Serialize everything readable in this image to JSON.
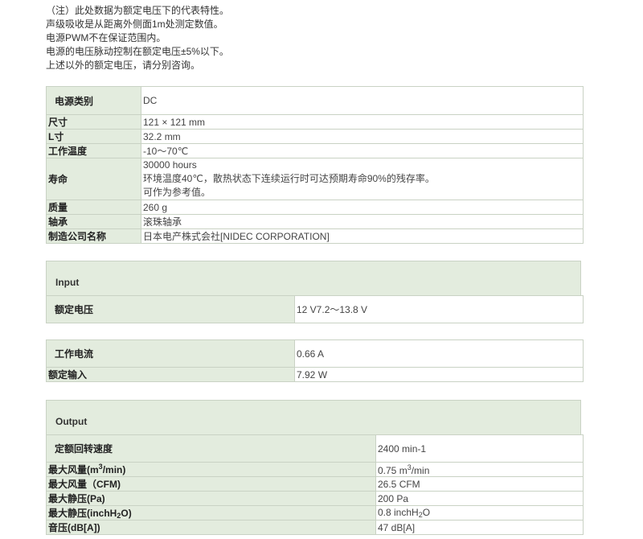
{
  "notes": [
    "（注）此处数据为额定电压下的代表特性。",
    "声级吸收是从距离外侧面1m处测定数值。",
    "电源PWM不在保证范围内。",
    "电源的电压脉动控制在额定电压±5%以下。",
    "上述以外的额定电压，请分别咨询。"
  ],
  "general": {
    "power_type_label": "电源类别",
    "power_type_value": "DC",
    "size_label": "尺寸",
    "size_value": "121 × 121 mm",
    "lsize_label": "L寸",
    "lsize_value": "32.2 mm",
    "temp_label": "工作温度",
    "temp_value": "-10～70℃",
    "life_label": "寿命",
    "life_value_1": "30000 hours",
    "life_value_2": "环境温度40℃，散热状态下连续运行时可达预期寿命90%的残存率。",
    "life_value_3": "可作为参考值。",
    "mass_label": "质量",
    "mass_value": "260 g",
    "bearing_label": "轴承",
    "bearing_value": "滚珠轴承",
    "maker_label": "制造公司名称",
    "maker_value": "日本电产株式会社[NIDEC CORPORATION]"
  },
  "input": {
    "heading": "Input",
    "rated_voltage_label": "额定电压",
    "rated_voltage_value": "12 V7.2～13.8 V",
    "current_label": "工作电流",
    "current_value": "0.66 A",
    "rated_input_label": "额定输入",
    "rated_input_value": "7.92 W"
  },
  "output": {
    "heading": "Output",
    "speed_label": "定额回转速度",
    "speed_value": "2400 min-1",
    "airflow_m3_label_pre": "最大风量(m",
    "airflow_m3_label_sup": "3",
    "airflow_m3_label_post": "/min)",
    "airflow_m3_value_pre": "0.75 m",
    "airflow_m3_value_sup": "3",
    "airflow_m3_value_post": "/min",
    "airflow_cfm_label": "最大风量（CFM)",
    "airflow_cfm_value": "26.5 CFM",
    "pressure_pa_label": "最大静压(Pa)",
    "pressure_pa_value": "200 Pa",
    "pressure_inch_label_pre": "最大静压(inchH",
    "pressure_inch_label_sub": "2",
    "pressure_inch_label_post": "O)",
    "pressure_inch_value_pre": "0.8 inchH",
    "pressure_inch_value_sub": "2",
    "pressure_inch_value_post": "O",
    "noise_label": "音压(dB[A])",
    "noise_value": "47 dB[A]"
  }
}
